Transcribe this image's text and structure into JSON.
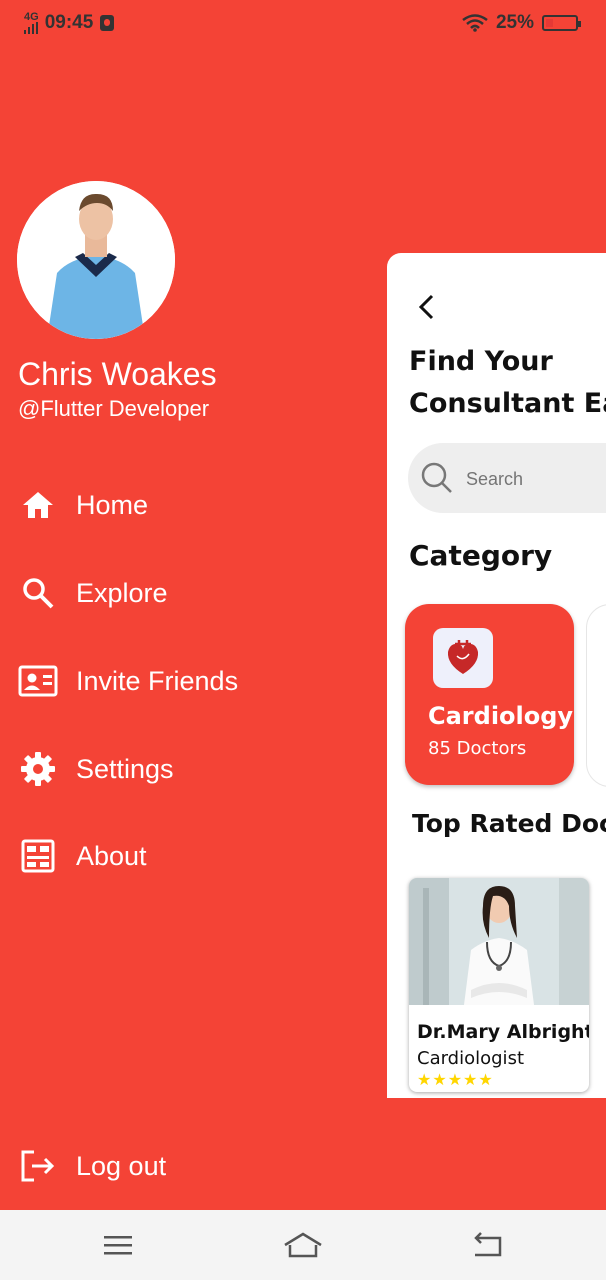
{
  "status_bar": {
    "network": "4G",
    "time": "09:45",
    "battery": "25%",
    "battery_level": 0.25
  },
  "profile": {
    "name": "Chris Woakes",
    "handle": "@Flutter Developer"
  },
  "drawer": {
    "items": [
      {
        "label": "Home",
        "icon": "home-icon"
      },
      {
        "label": "Explore",
        "icon": "search-icon"
      },
      {
        "label": "Invite Friends",
        "icon": "contact-card-icon"
      },
      {
        "label": "Settings",
        "icon": "gear-icon"
      },
      {
        "label": "About",
        "icon": "dashboard-icon"
      }
    ],
    "logout": "Log out"
  },
  "main": {
    "title_line1": "Find Your",
    "title_line2": "Consultant Eas",
    "search_placeholder": "Search",
    "category_title": "Category",
    "category": {
      "label": "Cardiology",
      "count": "85 Doctors"
    },
    "top_rated_title": "Top Rated Docto",
    "doctor": {
      "name": "Dr.Mary Albright",
      "specialty": "Cardiologist",
      "stars": "★★★★★"
    }
  },
  "colors": {
    "primary": "#F44336",
    "star": "#FFD600"
  }
}
